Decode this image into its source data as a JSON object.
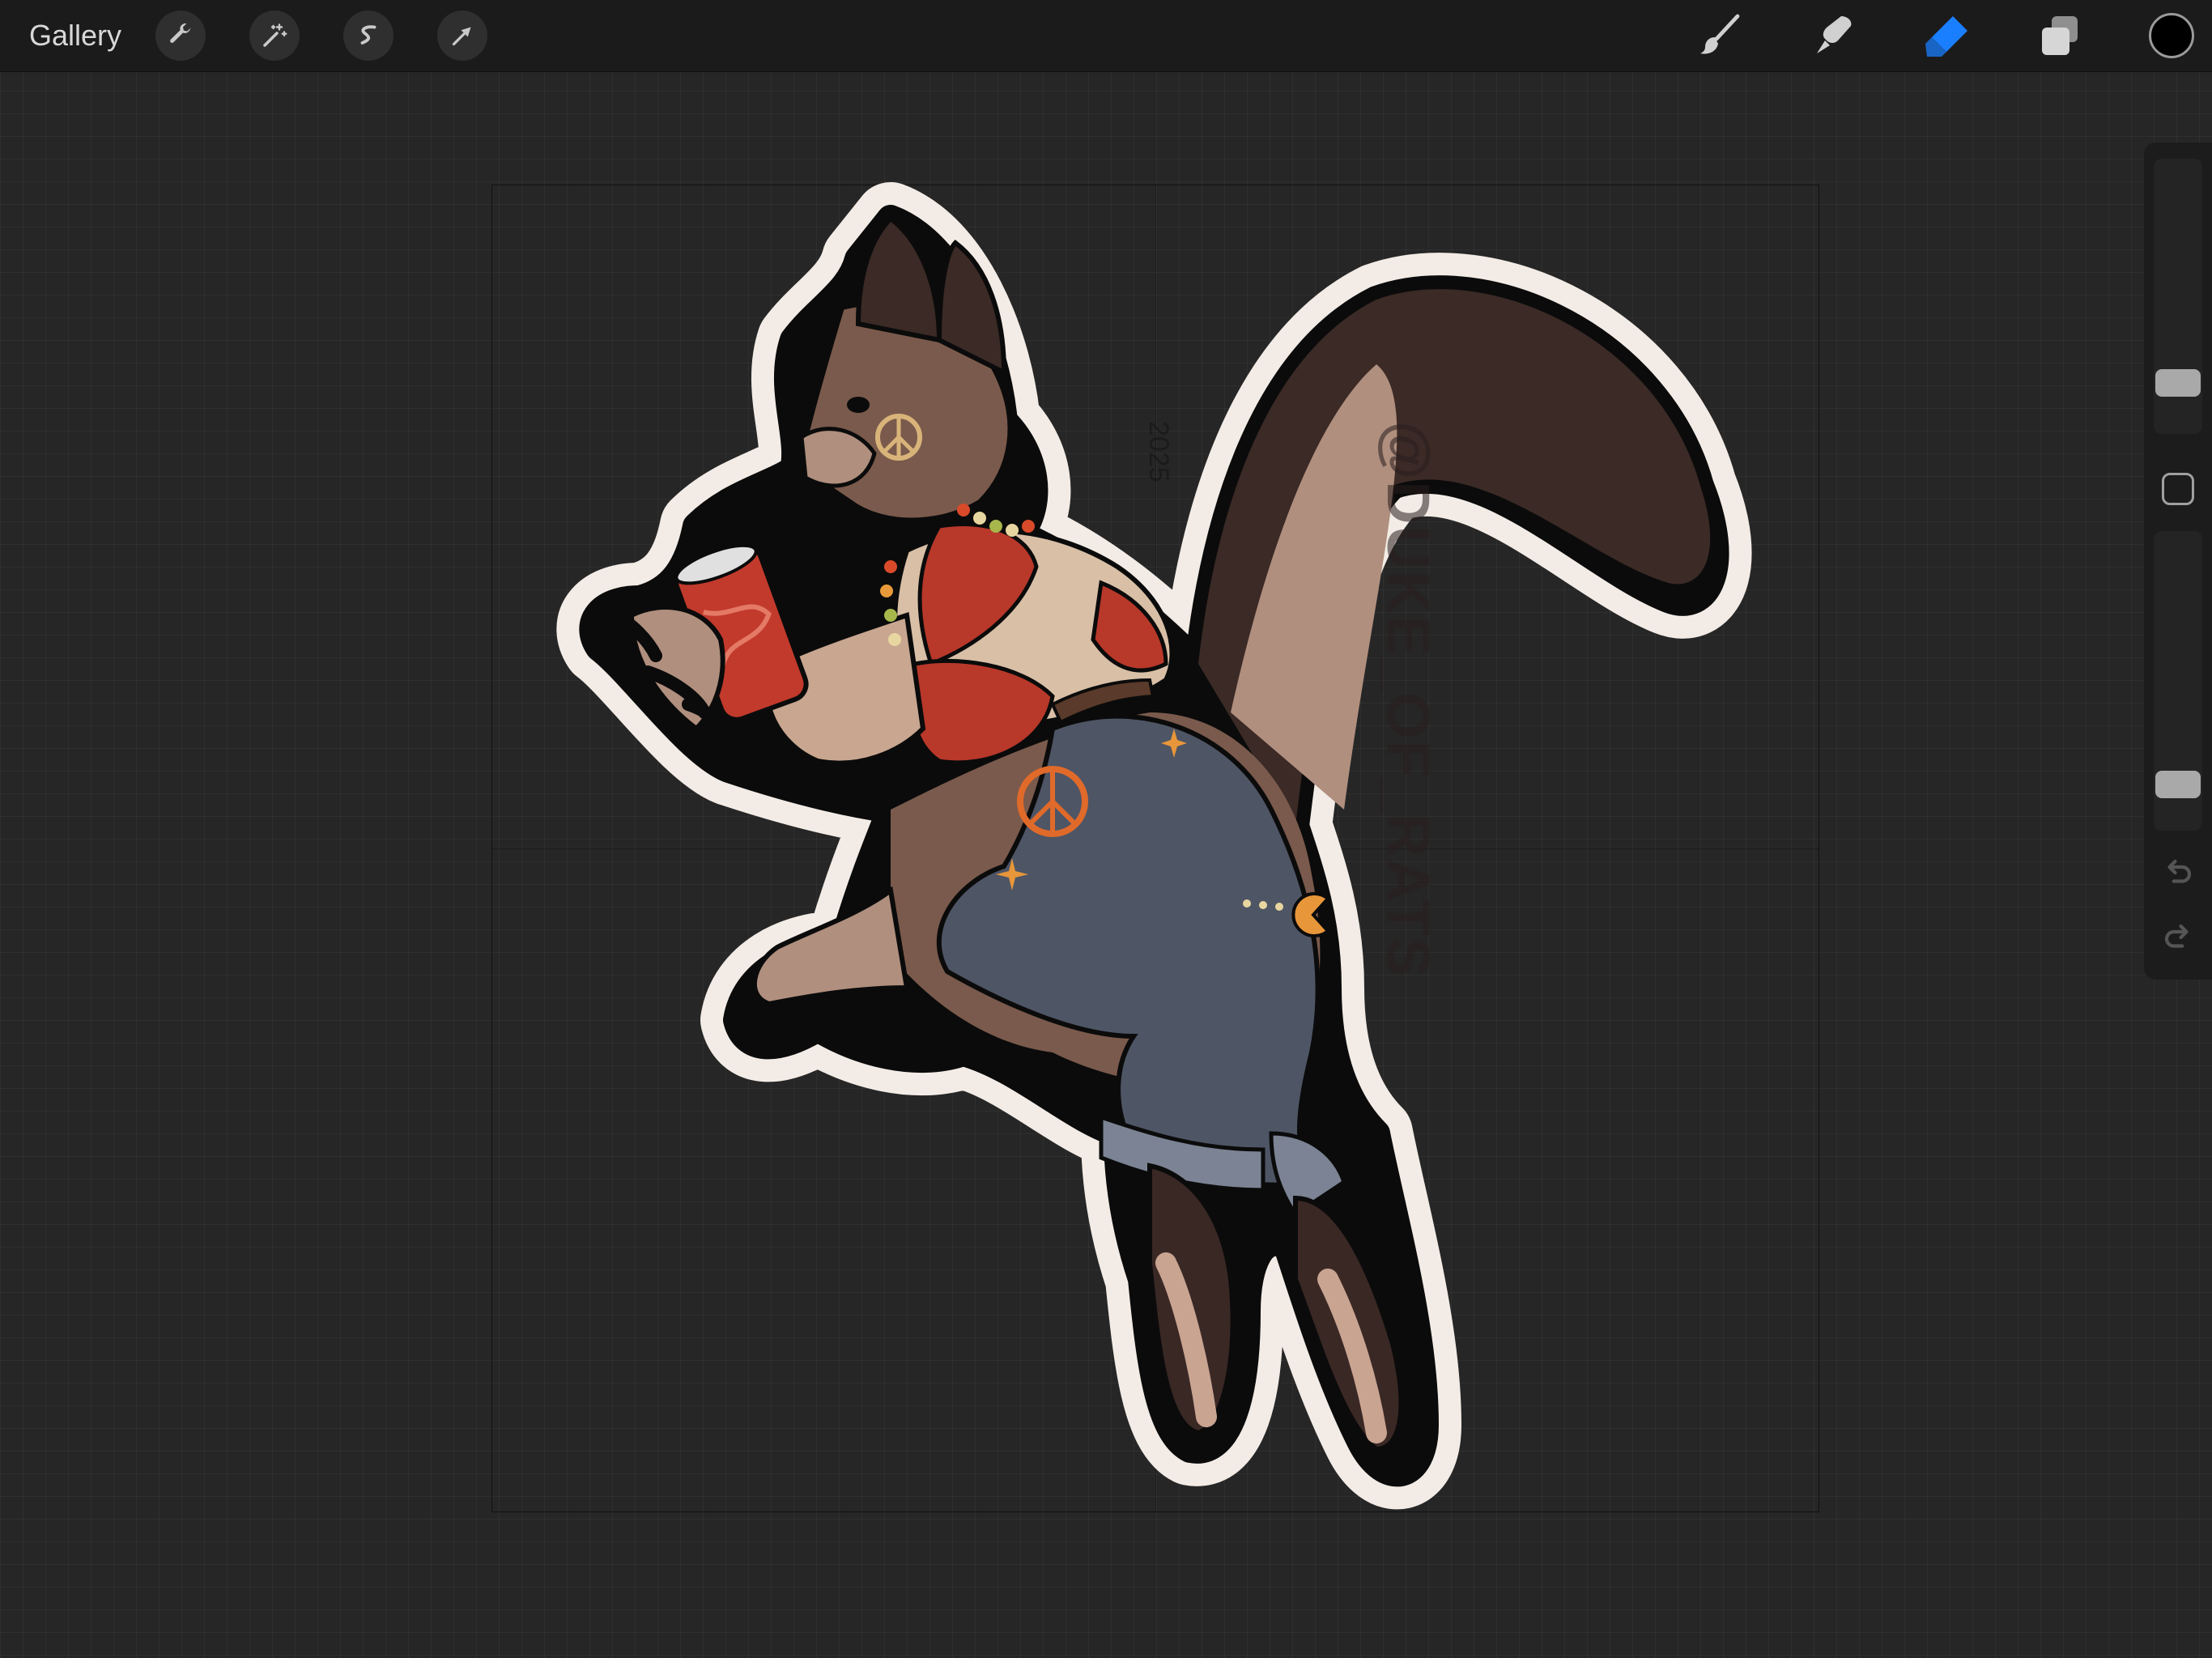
{
  "topbar": {
    "gallery_label": "Gallery",
    "left_tools": [
      "wrench-icon",
      "magic-wand-icon",
      "selection-icon",
      "transform-arrow-icon"
    ],
    "right_tools": [
      "brush-icon",
      "smudge-icon",
      "eraser-icon",
      "layers-icon"
    ],
    "active_tool": "eraser",
    "accent_color": "#1a7fff",
    "current_color": "#000000"
  },
  "canvas": {
    "watermark": "@DUKE_OF_RATS",
    "signature": "2025"
  },
  "sidebar": {
    "brush_size_level": 0.14,
    "opacity_level": 0.11,
    "undo_icon": "undo-icon",
    "redo_icon": "redo-icon"
  }
}
